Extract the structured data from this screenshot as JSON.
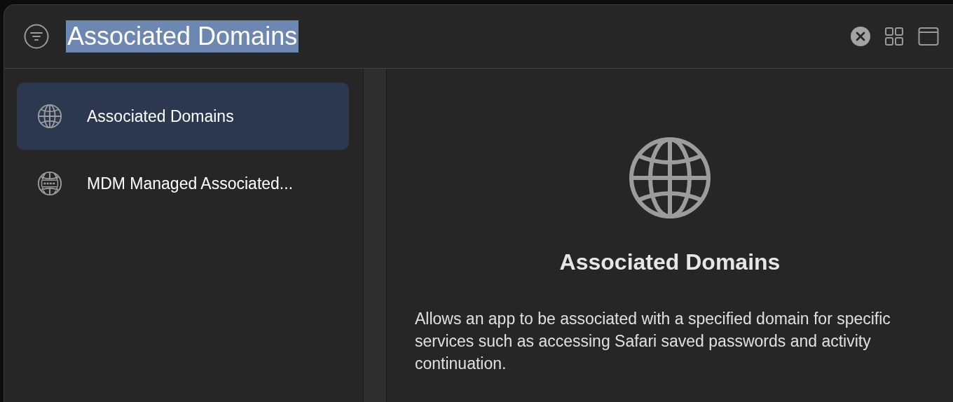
{
  "search": {
    "value": "Associated Domains",
    "text_selected": true
  },
  "sidebar": {
    "items": [
      {
        "label": "Associated Domains",
        "kind": "globe",
        "selected": true
      },
      {
        "label": "MDM Managed Associated...",
        "kind": "mdm-globe",
        "selected": false
      }
    ]
  },
  "detail": {
    "title": "Associated Domains",
    "description": "Allows an app to be associated with a specified domain for specific services such as accessing Safari saved passwords and activity continuation."
  }
}
